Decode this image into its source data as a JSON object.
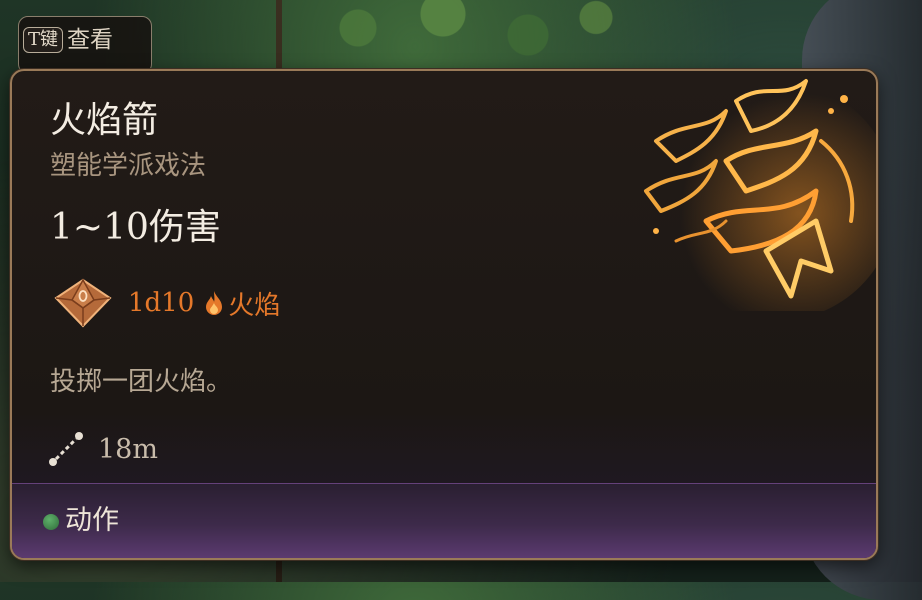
{
  "hotkey": {
    "key": "T键",
    "label": "查看"
  },
  "spell": {
    "name": "火焰箭",
    "school": "塑能学派戏法",
    "damage_range": "1~10伤害",
    "dice": "1d10",
    "damage_type": "火焰",
    "description": "投掷一团火焰。",
    "range": "18m"
  },
  "footer": {
    "action_type": "动作"
  },
  "icons": {
    "dice": "d10-dice-icon",
    "fire": "fire-damage-icon",
    "range": "range-icon",
    "action": "action-dot-icon"
  },
  "colors": {
    "damage": "#e5782a",
    "action": "#3d8f4a",
    "border": "#9a7a58"
  }
}
